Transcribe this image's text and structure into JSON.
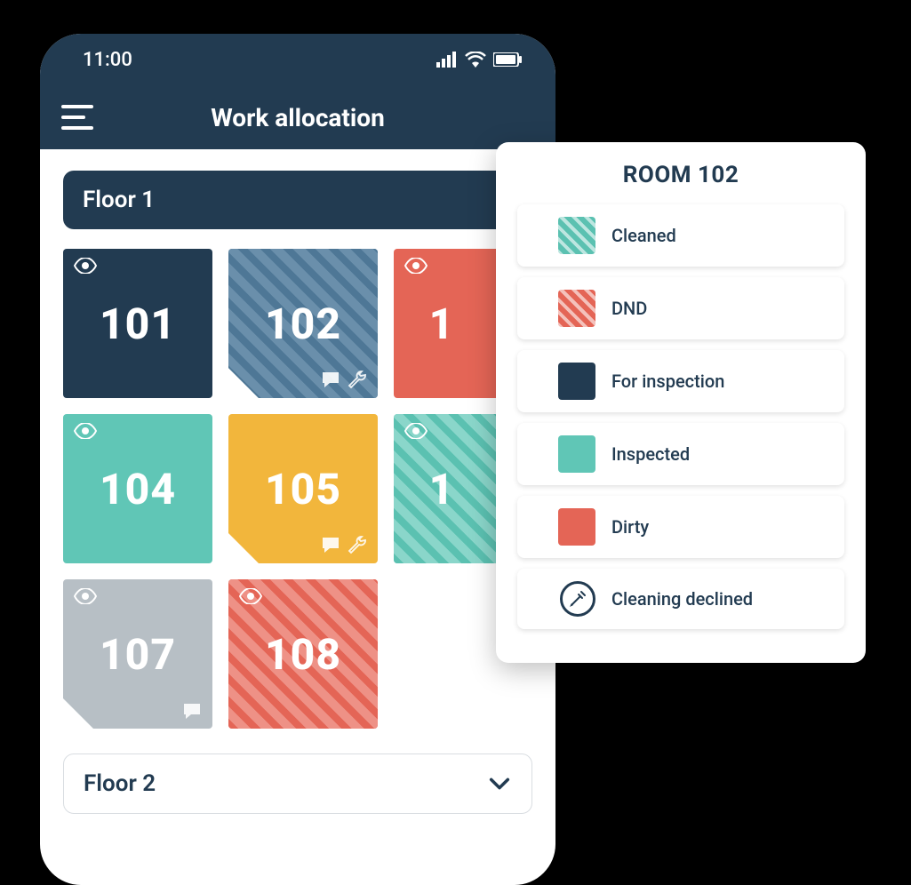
{
  "status_bar": {
    "time": "11:00"
  },
  "app": {
    "title": "Work allocation"
  },
  "floors": [
    {
      "label": "Floor 1"
    },
    {
      "label": "Floor 2"
    }
  ],
  "rooms": [
    {
      "number": "101"
    },
    {
      "number": "102"
    },
    {
      "number": "1"
    },
    {
      "number": "104"
    },
    {
      "number": "105"
    },
    {
      "number": "1"
    },
    {
      "number": "107"
    },
    {
      "number": "108"
    }
  ],
  "popup": {
    "title": "ROOM 102",
    "options": [
      {
        "label": "Cleaned"
      },
      {
        "label": "DND"
      },
      {
        "label": "For inspection"
      },
      {
        "label": "Inspected"
      },
      {
        "label": "Dirty"
      },
      {
        "label": "Cleaning declined"
      }
    ]
  },
  "colors": {
    "navy": "#223b51",
    "teal": "#60c6b6",
    "yellow": "#f2b63c",
    "red": "#e46556",
    "grey": "#b7bfc5"
  }
}
